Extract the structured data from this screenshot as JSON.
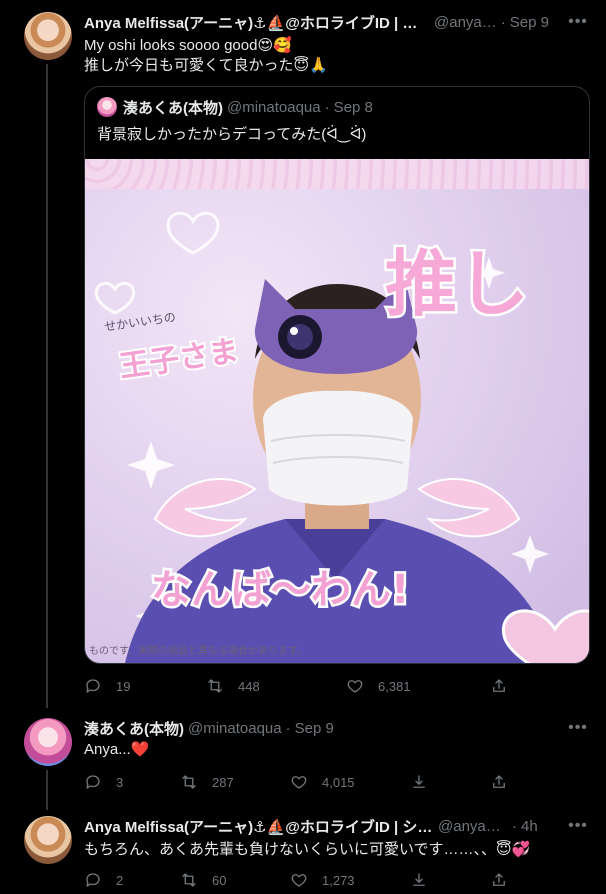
{
  "tweets": [
    {
      "name": "Anya Melfissa(アーニャ)⚓⛵@ホロライブID | シエ…",
      "handle": "@anya…",
      "time": "Sep 9",
      "lines": [
        "My oshi looks soooo good😍🥰",
        "推しが今日も可愛くて良かった😇🙏"
      ],
      "quote": {
        "name": "湊あくあ(本物)",
        "handle": "@minatoaqua",
        "time": "Sep 8",
        "text": "背景寂しかったからデコってみた(ᐛ‿ᐛ)",
        "media": {
          "kanji_big": "推し",
          "caption_top": "せかいいちの",
          "caption_prince": "王子さま",
          "caption_bottom": "なんば〜わん!",
          "watermark": "ものです。実際の商品と異なる場合があります。"
        }
      },
      "stats": {
        "replies": "19",
        "retweets": "448",
        "likes": "6,381"
      }
    },
    {
      "name": "湊あくあ(本物)",
      "handle": "@minatoaqua",
      "time": "Sep 9",
      "text": "Anya...❤️",
      "stats": {
        "replies": "3",
        "retweets": "287",
        "likes": "4,015"
      }
    },
    {
      "name": "Anya Melfissa(アーニャ)⚓⛵@ホロライブID | シエ…",
      "handle": "@anyam…",
      "time": "4h",
      "text": "もちろん、あくあ先輩も負けないくらいに可愛いです……、、😇💞",
      "stats": {
        "replies": "2",
        "retweets": "60",
        "likes": "1,273"
      }
    }
  ],
  "icons": {
    "more": "more-icon",
    "reply": "reply-icon",
    "retweet": "retweet-icon",
    "like": "like-icon",
    "share": "share-icon"
  },
  "colors": {
    "background": "#000000",
    "text": "#e7e9ea",
    "muted": "#71767b",
    "border": "#2f3336"
  }
}
